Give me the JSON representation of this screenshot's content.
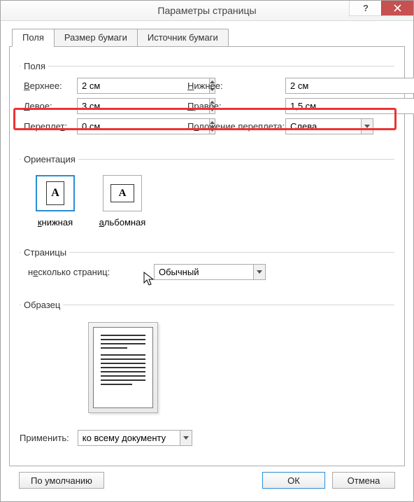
{
  "window": {
    "title": "Параметры страницы"
  },
  "tabs": {
    "a": "Поля",
    "b": "Размер бумаги",
    "c": "Источник бумаги"
  },
  "groups": {
    "margins": "Поля",
    "orient": "Ориентация",
    "pages": "Страницы",
    "preview": "Образец"
  },
  "labels": {
    "top": "Верхнее:",
    "bottom": "Нижнее:",
    "left": "Левое:",
    "right": "Правое:",
    "gutter": "Переплет:",
    "gutterpos": "Положение переплета:",
    "multi": "несколько страниц:",
    "apply": "Применить:"
  },
  "values": {
    "top": "2 см",
    "bottom": "2 см",
    "left": "3 см",
    "right": "1,5 см",
    "gutter": "0 см",
    "gutterpos": "Слева",
    "multi": "Обычный",
    "apply": "ко всему документу"
  },
  "orient": {
    "portrait": "книжная",
    "landscape": "альбомная",
    "glyph": "A"
  },
  "buttons": {
    "default": "По умолчанию",
    "ok": "ОК",
    "cancel": "Отмена"
  }
}
